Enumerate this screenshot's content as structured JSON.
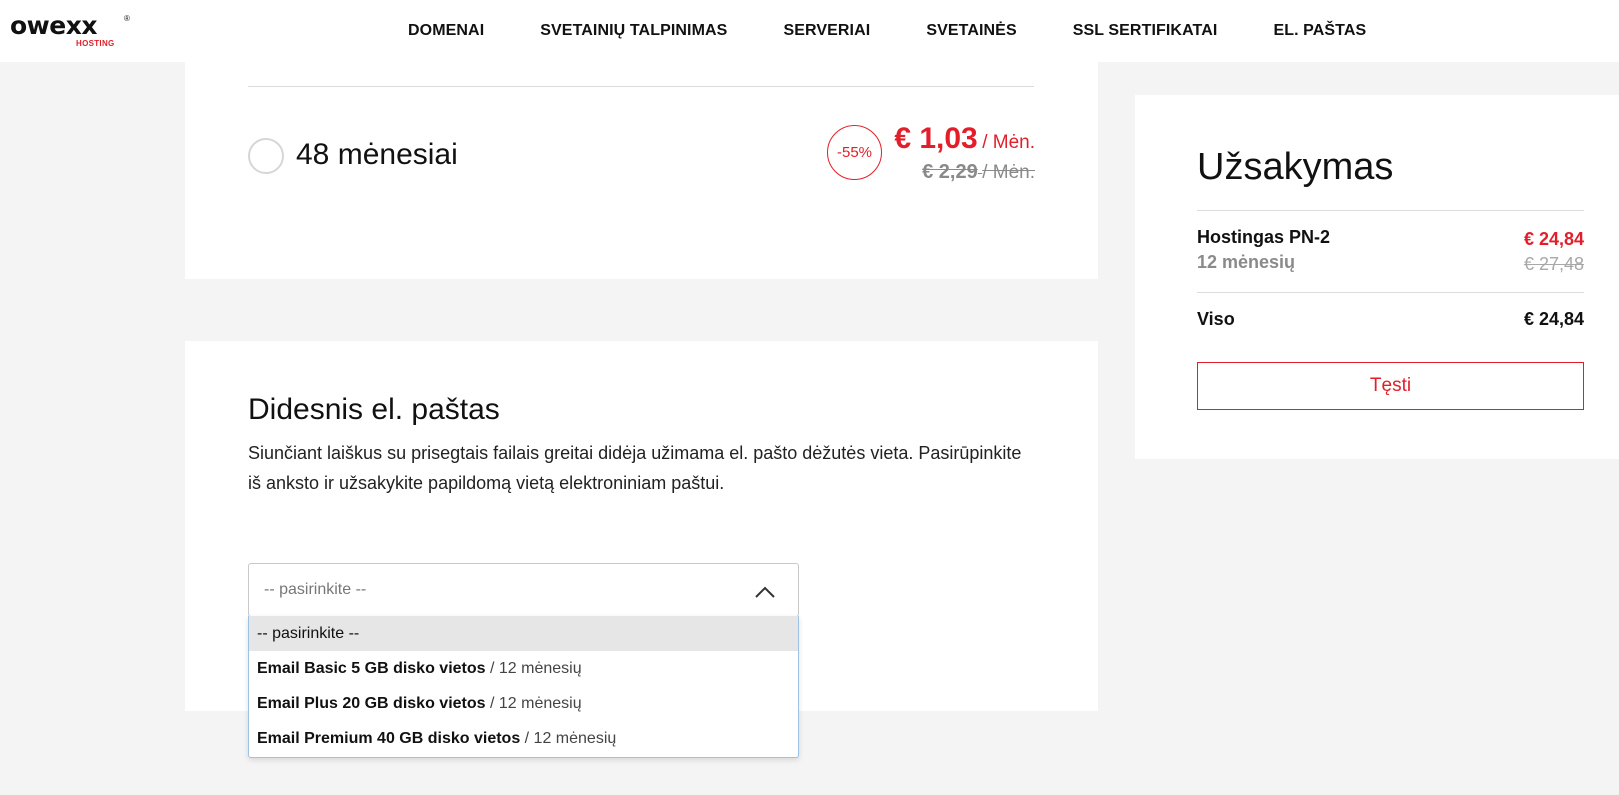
{
  "brand": {
    "logo_word": "owexx",
    "logo_sub": "HOSTING",
    "logo_reg": "®",
    "accent_color": "#e31e2a"
  },
  "nav": {
    "items": [
      {
        "label": "DOMENAI"
      },
      {
        "label": "SVETAINIŲ TALPINIMAS"
      },
      {
        "label": "SERVERIAI"
      },
      {
        "label": "SVETAINĖS"
      },
      {
        "label": "SSL SERTIFIKATAI"
      },
      {
        "label": "EL. PAŠTAS"
      }
    ]
  },
  "period_option": {
    "label": "48 mėnesiai",
    "selected": false,
    "discount": "-55%",
    "price_new": "€ 1,03",
    "price_new_unit": "/ Mėn.",
    "price_old": "€ 2,29",
    "price_old_unit": "/ Mėn."
  },
  "email_section": {
    "title": "Didesnis el. paštas",
    "description": "Siunčiant laiškus su prisegtais failais greitai didėja užimama el. pašto dėžutės vieta. Pasirūpinkite iš anksto ir užsakykite papildomą vietą elektroniniam paštui.",
    "select": {
      "value": "-- pasirinkite --",
      "expanded": true,
      "options": [
        {
          "bold": "",
          "rest": "-- pasirinkite --",
          "selected": true
        },
        {
          "bold": "Email Basic 5 GB disko vietos",
          "rest": " / 12 mėnesių",
          "selected": false
        },
        {
          "bold": "Email Plus 20 GB disko vietos",
          "rest": " / 12 mėnesių",
          "selected": false
        },
        {
          "bold": "Email Premium 40 GB disko vietos",
          "rest": " / 12 mėnesių",
          "selected": false
        }
      ]
    }
  },
  "order": {
    "title": "Užsakymas",
    "item_name": "Hostingas PN-2",
    "item_period": "12 mėnesių",
    "item_price": "€ 24,84",
    "item_old_price": "€ 27,48",
    "total_label": "Viso",
    "total_value": "€ 24,84",
    "continue_label": "Tęsti"
  }
}
